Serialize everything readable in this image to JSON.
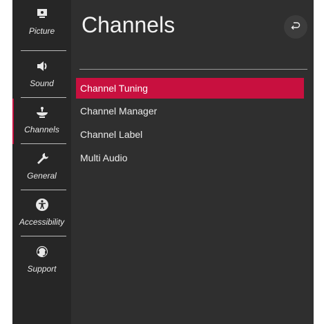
{
  "title": "Channels",
  "sidebar": {
    "items": [
      {
        "label": "Picture",
        "icon": "picture-icon"
      },
      {
        "label": "Sound",
        "icon": "speaker-icon"
      },
      {
        "label": "Channels",
        "icon": "satellite-dish-icon"
      },
      {
        "label": "General",
        "icon": "wrench-icon"
      },
      {
        "label": "Accessibility",
        "icon": "accessibility-icon"
      },
      {
        "label": "Support",
        "icon": "support-headset-icon"
      }
    ],
    "active": "Channels"
  },
  "menu": {
    "items": [
      {
        "label": "Channel Tuning"
      },
      {
        "label": "Channel Manager"
      },
      {
        "label": "Channel Label"
      },
      {
        "label": "Multi Audio"
      }
    ],
    "selected": "Channel Tuning"
  },
  "colors": {
    "accent": "#c8103f",
    "panel": "#2f2f2f",
    "sidebar": "#262626"
  }
}
